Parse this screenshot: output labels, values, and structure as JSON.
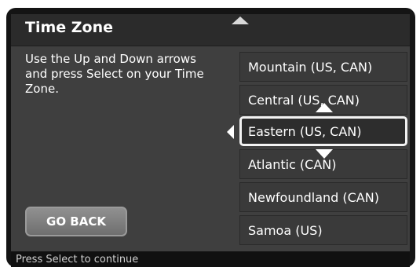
{
  "header": {
    "title": "Time Zone"
  },
  "instructions": "Use the Up and Down arrows and press Select on your Time Zone.",
  "timezones": [
    {
      "label": "Mountain (US, CAN)",
      "selected": false
    },
    {
      "label": "Central (US, CAN)",
      "selected": false
    },
    {
      "label": "Eastern (US, CAN)",
      "selected": true
    },
    {
      "label": "Atlantic (CAN)",
      "selected": false
    },
    {
      "label": "Newfoundland (CAN)",
      "selected": false
    },
    {
      "label": "Samoa (US)",
      "selected": false
    }
  ],
  "buttons": {
    "go_back": "GO BACK"
  },
  "status": "Press Select to continue",
  "icons": {
    "scroll_up": "chevron-up-icon",
    "selection_pointer": "caret-left-icon",
    "navigate_up": "arrow-up-icon",
    "navigate_down": "arrow-down-icon"
  },
  "colors": {
    "panel": "#3f3f3f",
    "title_bar": "#2b2b2b",
    "frame": "#141414",
    "selected_border": "#f2f2f2",
    "text": "#ffffff"
  }
}
